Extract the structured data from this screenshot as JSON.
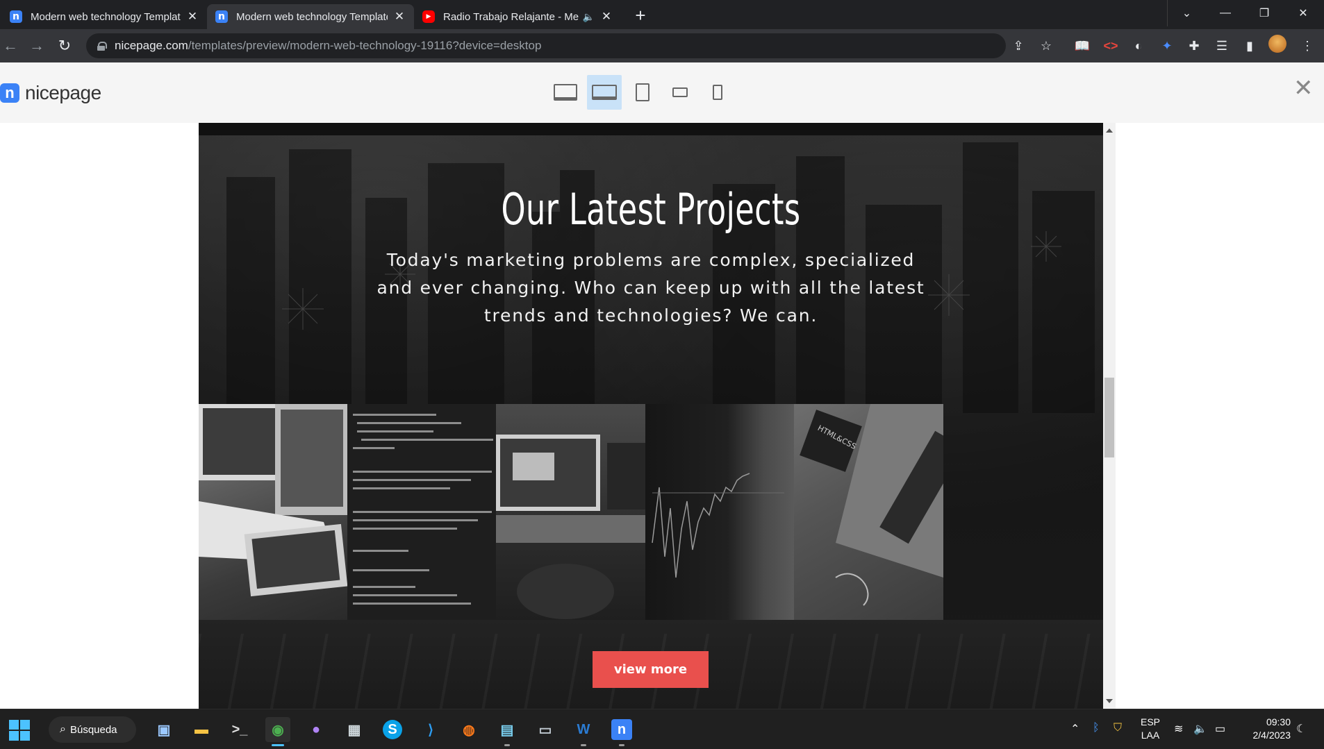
{
  "browser": {
    "tabs": [
      {
        "title": "Modern web technology Template",
        "favicon": "nicepage-icon",
        "active": false
      },
      {
        "title": "Modern web technology Template",
        "favicon": "nicepage-icon",
        "active": true
      },
      {
        "title": "Radio Trabajo Relajante - Me",
        "favicon": "youtube-icon",
        "active": false,
        "audio": true
      }
    ],
    "url_host": "nicepage.com",
    "url_path": "/templates/preview/modern-web-technology-19116?device=desktop"
  },
  "nicepage": {
    "logo_text": "nicepage",
    "devices": [
      "desktop-icon",
      "laptop-icon",
      "tablet-icon",
      "phone-landscape-icon",
      "phone-icon"
    ],
    "active_device": "laptop-icon"
  },
  "section": {
    "title": "Our Latest Projects",
    "text": "Today's marketing problems are complex, specialized and ever changing. Who can keep up with all the latest trends and technologies? We can.",
    "button": "view more",
    "accent": "#e9504d",
    "gallery": [
      {
        "subject": "laptop-and-tablet-photo"
      },
      {
        "subject": "code-screen-photo"
      },
      {
        "subject": "desk-monitor-photo"
      },
      {
        "subject": "stock-chart-photo"
      },
      {
        "subject": "html-css-laptop-photo",
        "label": "HTML&CSS"
      }
    ]
  },
  "taskbar": {
    "search_label": "Búsqueda",
    "lang_line1": "ESP",
    "lang_line2": "LAA",
    "time": "09:30",
    "date": "2/4/2023"
  }
}
